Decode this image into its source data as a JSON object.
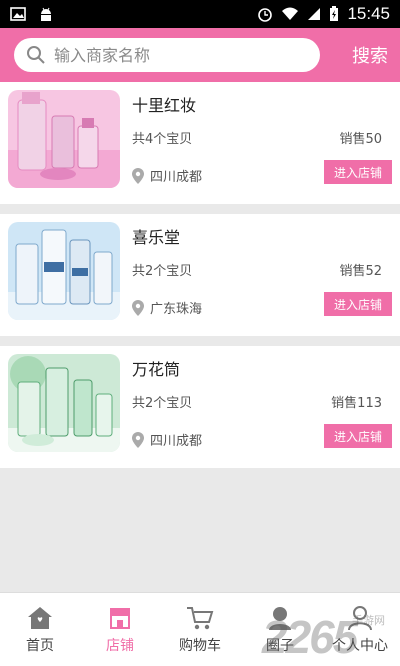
{
  "status_bar": {
    "time": "15:45"
  },
  "search": {
    "placeholder": "输入商家名称",
    "button_label": "搜索"
  },
  "shops": [
    {
      "name": "十里红妆",
      "item_count": "共4个宝贝",
      "sales": "销售50",
      "location": "四川成都",
      "enter_label": "进入店铺"
    },
    {
      "name": "喜乐堂",
      "item_count": "共2个宝贝",
      "sales": "销售52",
      "location": "广东珠海",
      "enter_label": "进入店铺"
    },
    {
      "name": "万花筒",
      "item_count": "共2个宝贝",
      "sales": "销售113",
      "location": "四川成都",
      "enter_label": "进入店铺"
    }
  ],
  "tabs": [
    {
      "label": "首页",
      "icon": "home-icon"
    },
    {
      "label": "店铺",
      "icon": "store-icon",
      "active": true
    },
    {
      "label": "购物车",
      "icon": "cart-icon"
    },
    {
      "label": "圈子",
      "icon": "circle-icon"
    },
    {
      "label": "个人中心",
      "icon": "user-icon"
    }
  ],
  "watermark": {
    "brand": "2265",
    "site": "手游网"
  },
  "colors": {
    "accent": "#f06ea8",
    "background": "#e9e9e9"
  }
}
